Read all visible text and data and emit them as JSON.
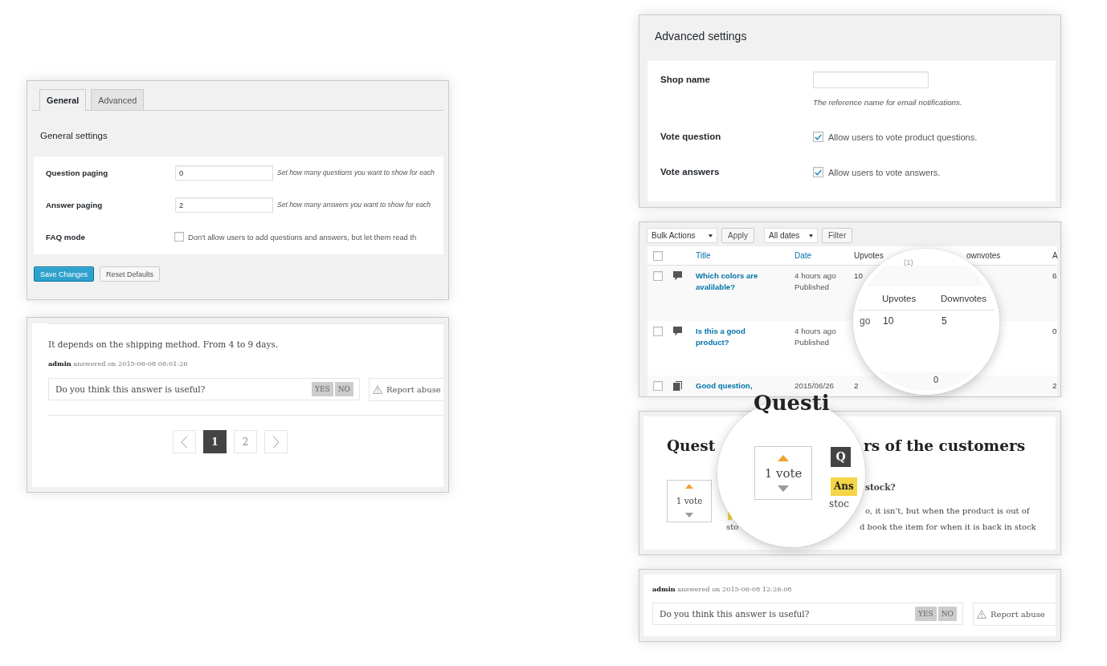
{
  "general_panel": {
    "tabs": [
      {
        "label": "General",
        "selected": true
      },
      {
        "label": "Advanced",
        "selected": false
      }
    ],
    "heading": "General settings",
    "fields": [
      {
        "kind": "number",
        "label": "Question paging",
        "value": "0",
        "description": "Set how many questions you want to show for each"
      },
      {
        "kind": "number",
        "label": "Answer paging",
        "value": "2",
        "description": "Set how many answers you want to show for each"
      },
      {
        "kind": "checkbox",
        "label": "FAQ mode",
        "checked": false,
        "description": "Don't allow users to add questions and answers, but let them read th"
      }
    ],
    "buttons": [
      {
        "kind": "primary",
        "label": "Save Changes"
      },
      {
        "kind": "secondary",
        "label": "Reset Defaults"
      }
    ]
  },
  "answer_preview": {
    "answer": "It depends on the shipping method. From 4 to 9 days.",
    "meta": "**admin** answered on 2015-06-08 08:01:26",
    "useful_prompt": "Do you think this answer is useful?",
    "vote_buttons": [
      "YES",
      "NO"
    ],
    "report": "Report abuse",
    "pages": [
      {
        "label": "1",
        "selected": true
      },
      {
        "label": "2",
        "selected": false
      }
    ]
  },
  "advanced_panel": {
    "heading": "Advanced settings",
    "fields": [
      {
        "kind": "text",
        "label": "Shop name",
        "description": "The reference name for email notifications."
      },
      {
        "kind": "checkbox",
        "label": "Vote question",
        "checked": true,
        "description": "Allow users to vote product questions."
      },
      {
        "kind": "checkbox",
        "label": "Vote answers",
        "checked": true,
        "description": "Allow users to vote answers."
      }
    ]
  },
  "questions_table": {
    "toolbar": [
      {
        "kind": "select",
        "label": "Bulk Actions"
      },
      {
        "kind": "button",
        "label": "Apply"
      },
      {
        "kind": "select",
        "label": "All dates"
      },
      {
        "kind": "button",
        "label": "Filter"
      }
    ],
    "header_checkbox": {
      "checked": false
    },
    "columns": [
      {
        "label": "Title",
        "sortable": true
      },
      {
        "label": "Date",
        "sortable": true
      },
      {
        "label": "Upvotes",
        "sortable": false
      },
      {
        "label": "ownvotes",
        "sortable": false
      },
      {
        "label": "A",
        "sortable": false
      }
    ],
    "rows": [
      {
        "kind": "question",
        "selected": false,
        "title": "Which colors are avalilable?",
        "date": "4 hours ago",
        "status": "Published",
        "upvotes": "10",
        "column_8": "6"
      },
      {
        "kind": "question",
        "selected": false,
        "title": "Is this a good product?",
        "date": "4 hours ago",
        "status": "Published",
        "column_8": "0"
      },
      {
        "kind": "answer",
        "selected": false,
        "title": "Good question,",
        "date": "2015/06/26",
        "upvotes": "2",
        "column_8": "2"
      }
    ],
    "magnifier": {
      "header_fragment": "(1)",
      "columns": [
        "Upvotes",
        "Downvotes"
      ],
      "row_fragment": "go",
      "values": [
        "10",
        "5"
      ],
      "lower_value": "0"
    }
  },
  "questions_preview": {
    "heading_start": "Quest",
    "heading_end": "rs of the customers",
    "votes": "1 vote",
    "question_end": "stock?",
    "answer_line_1": "o, it isn't, but when the product is out of",
    "answer_line_2_start": "sto",
    "answer_line_2_end": "d book the item for when it is back in stock",
    "magnifier": {
      "heading": "Questi",
      "votes": "1 vote",
      "badge": "Q",
      "label": "Ans",
      "text": "stoc"
    }
  },
  "answer_footer": {
    "meta": "**admin** answered on 2015-06-08 12:26:08",
    "useful_prompt": "Do you think this answer is useful?",
    "vote_buttons": [
      "YES",
      "NO"
    ],
    "report": "Report abuse"
  }
}
